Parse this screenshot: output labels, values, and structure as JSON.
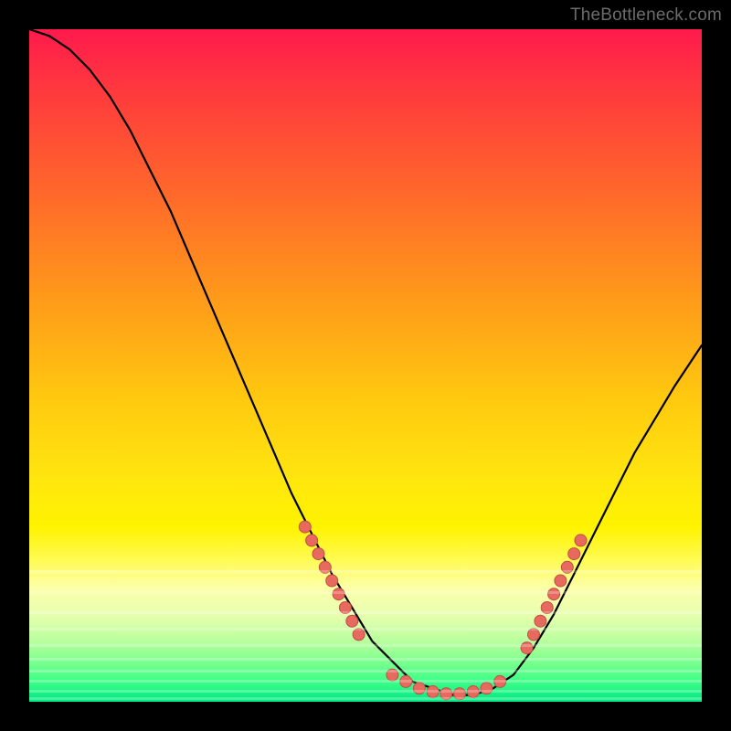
{
  "watermark": "TheBottleneck.com",
  "colors": {
    "frame": "#000000",
    "curve_stroke": "#000000",
    "marker_fill": "#e86a5e",
    "marker_stroke": "#be4f46"
  },
  "chart_data": {
    "type": "line",
    "title": "",
    "xlabel": "",
    "ylabel": "",
    "xlim": [
      0,
      100
    ],
    "ylim": [
      0,
      100
    ],
    "grid": false,
    "series": [
      {
        "name": "bottleneck-curve",
        "x": [
          0,
          3,
          6,
          9,
          12,
          15,
          18,
          21,
          24,
          27,
          30,
          33,
          36,
          39,
          42,
          45,
          48,
          51,
          54,
          57,
          60,
          63,
          66,
          69,
          72,
          75,
          78,
          81,
          84,
          87,
          90,
          93,
          96,
          100
        ],
        "y": [
          100,
          99,
          97,
          94,
          90,
          85,
          79,
          73,
          66,
          59,
          52,
          45,
          38,
          31,
          25,
          19,
          14,
          9,
          6,
          3,
          2,
          1,
          1,
          2,
          4,
          8,
          13,
          19,
          25,
          31,
          37,
          42,
          47,
          53
        ]
      }
    ],
    "marker_clusters": [
      {
        "name": "left-descent-cluster",
        "points": [
          {
            "x": 41,
            "y": 26
          },
          {
            "x": 42,
            "y": 24
          },
          {
            "x": 43,
            "y": 22
          },
          {
            "x": 44,
            "y": 20
          },
          {
            "x": 45,
            "y": 18
          },
          {
            "x": 46,
            "y": 16
          },
          {
            "x": 47,
            "y": 14
          },
          {
            "x": 48,
            "y": 12
          },
          {
            "x": 49,
            "y": 10
          }
        ]
      },
      {
        "name": "trough-cluster",
        "points": [
          {
            "x": 54,
            "y": 4
          },
          {
            "x": 56,
            "y": 3
          },
          {
            "x": 58,
            "y": 2
          },
          {
            "x": 60,
            "y": 1.5
          },
          {
            "x": 62,
            "y": 1.2
          },
          {
            "x": 64,
            "y": 1.2
          },
          {
            "x": 66,
            "y": 1.5
          },
          {
            "x": 68,
            "y": 2
          },
          {
            "x": 70,
            "y": 3
          }
        ]
      },
      {
        "name": "right-ascent-cluster",
        "points": [
          {
            "x": 74,
            "y": 8
          },
          {
            "x": 75,
            "y": 10
          },
          {
            "x": 76,
            "y": 12
          },
          {
            "x": 77,
            "y": 14
          },
          {
            "x": 78,
            "y": 16
          },
          {
            "x": 79,
            "y": 18
          },
          {
            "x": 80,
            "y": 20
          },
          {
            "x": 81,
            "y": 22
          },
          {
            "x": 82,
            "y": 24
          }
        ]
      }
    ],
    "bottom_stripes_y_pct": [
      80.5,
      83.5,
      86.5,
      89,
      91.5,
      93.5,
      95.2,
      96.8,
      98.2,
      99.3
    ]
  }
}
